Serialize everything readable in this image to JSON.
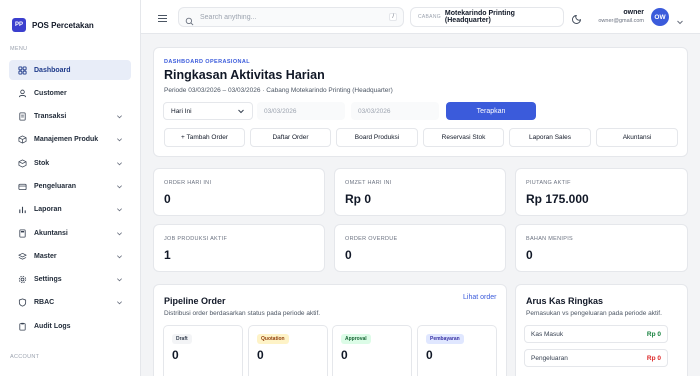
{
  "brand": {
    "logo_text": "PP",
    "name": "POS Percetakan"
  },
  "sidebar": {
    "menu_label": "MENU",
    "account_label": "ACCOUNT",
    "items": [
      {
        "label": "Dashboard",
        "icon": "grid-icon",
        "active": true,
        "has_chevron": false
      },
      {
        "label": "Customer",
        "icon": "user-icon",
        "active": false,
        "has_chevron": false
      },
      {
        "label": "Transaksi",
        "icon": "receipt-icon",
        "active": false,
        "has_chevron": true
      },
      {
        "label": "Manajemen Produk",
        "icon": "box-icon",
        "active": false,
        "has_chevron": true
      },
      {
        "label": "Stok",
        "icon": "cube-icon",
        "active": false,
        "has_chevron": true
      },
      {
        "label": "Pengeluaran",
        "icon": "wallet-icon",
        "active": false,
        "has_chevron": true
      },
      {
        "label": "Laporan",
        "icon": "bar-chart-icon",
        "active": false,
        "has_chevron": true
      },
      {
        "label": "Akuntansi",
        "icon": "calculator-icon",
        "active": false,
        "has_chevron": true
      },
      {
        "label": "Master",
        "icon": "layers-icon",
        "active": false,
        "has_chevron": true
      },
      {
        "label": "Settings",
        "icon": "gear-icon",
        "active": false,
        "has_chevron": true
      },
      {
        "label": "RBAC",
        "icon": "shield-icon",
        "active": false,
        "has_chevron": true
      },
      {
        "label": "Audit Logs",
        "icon": "clipboard-icon",
        "active": false,
        "has_chevron": false
      }
    ]
  },
  "topbar": {
    "search_placeholder": "Search anything...",
    "search_shortcut": "/",
    "branch_label": "CABANG",
    "branch_value": "Motekarindo Printing (Headquarter)",
    "user_name": "owner",
    "user_email": "owner@gmail.com",
    "avatar_initials": "OW"
  },
  "header": {
    "eyebrow": "DASHBOARD OPERASIONAL",
    "title": "Ringkasan Aktivitas Harian",
    "period": "Periode 03/03/2026 – 03/03/2026 · Cabang Motekarindo Printing (Headquarter)"
  },
  "filters": {
    "range_select": "Hari Ini",
    "date_from": "03/03/2026",
    "date_to": "03/03/2026",
    "apply_label": "Terapkan"
  },
  "quick_actions": [
    "+ Tambah Order",
    "Daftar Order",
    "Board Produksi",
    "Reservasi Stok",
    "Laporan Sales",
    "Akuntansi"
  ],
  "stats": [
    {
      "label": "ORDER HARI INI",
      "value": "0"
    },
    {
      "label": "OMZET HARI INI",
      "value": "Rp 0"
    },
    {
      "label": "PIUTANG AKTIF",
      "value": "Rp 175.000"
    },
    {
      "label": "JOB PRODUKSI AKTIF",
      "value": "1"
    },
    {
      "label": "ORDER OVERDUE",
      "value": "0"
    },
    {
      "label": "BAHAN MENIPIS",
      "value": "0"
    }
  ],
  "pipeline": {
    "title": "Pipeline Order",
    "subtitle": "Distribusi order berdasarkan status pada periode aktif.",
    "link": "Lihat order",
    "statuses": [
      {
        "label": "Draft",
        "value": "0",
        "bg": "#f3f4f6",
        "fg": "#374151"
      },
      {
        "label": "Quotation",
        "value": "0",
        "bg": "#fef3c7",
        "fg": "#92400e"
      },
      {
        "label": "Approval",
        "value": "0",
        "bg": "#dcfce7",
        "fg": "#166534"
      },
      {
        "label": "Pembayaran",
        "value": "0",
        "bg": "#e0e7ff",
        "fg": "#3730a3"
      }
    ]
  },
  "cashflow": {
    "title": "Arus Kas Ringkas",
    "subtitle": "Pemasukan vs pengeluaran pada periode aktif.",
    "rows": [
      {
        "label": "Kas Masuk",
        "value": "Rp 0",
        "color": "#15803d"
      },
      {
        "label": "Pengeluaran",
        "value": "Rp 0",
        "color": "#dc2626"
      }
    ]
  },
  "colors": {
    "accent": "#3b5bdb",
    "active_nav_bg": "#e8edf8",
    "brand": "#3b3fce"
  }
}
